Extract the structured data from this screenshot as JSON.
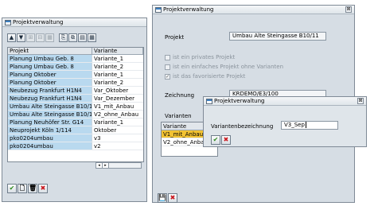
{
  "window1": {
    "title": "Projektverwaltung",
    "toolbar": [
      "▲",
      "▼",
      "⊞",
      "⊟",
      "▦",
      "⎘",
      "⧉",
      "▤",
      "▦"
    ],
    "table": {
      "headers": [
        "Projekt",
        "Variante"
      ],
      "rows": [
        [
          "Planung Umbau Geb. 8",
          "Variante_1"
        ],
        [
          "Planung Umbau Geb. 8",
          "Variante_2"
        ],
        [
          "Planung Oktober",
          "Variante_1"
        ],
        [
          "Planung Oktober",
          "Variante_2"
        ],
        [
          "Neubezug Frankfurt H1N4",
          "Var_Oktober"
        ],
        [
          "Neubezug Frankfurt H1N4",
          "Var_Dezember"
        ],
        [
          "Umbau Alte Steingasse B10/11",
          "V1_mit_Anbau"
        ],
        [
          "Umbau Alte Steingasse B10/11",
          "V2_ohne_Anbau"
        ],
        [
          "Planung Neuhöfer Str. G14",
          "Variante_1"
        ],
        [
          "Neuprojekt Köln 1/114",
          "Oktober"
        ],
        [
          "pko0204umbau",
          "v3"
        ],
        [
          "pko0204umbau",
          "v2"
        ]
      ]
    },
    "scroll": {
      "left": "◂",
      "right": "▸"
    },
    "bottom": {
      "check": "✔",
      "new": "🗋",
      "delete": "🗑",
      "cancel": "✖"
    }
  },
  "window2": {
    "title": "Projektverwaltung",
    "close": "⊠",
    "projekt_label": "Projekt",
    "projekt_value": "Umbau Alte Steingasse B10/11",
    "checkboxes": [
      {
        "label": "ist ein privates Projekt",
        "checked": false
      },
      {
        "label": "ist ein einfaches Projekt ohne Varianten",
        "checked": false
      },
      {
        "label": "ist das favorisierte Projekt",
        "checked": true
      }
    ],
    "checkmark": "✓",
    "zeichnung_label": "Zeichnung",
    "zeichnung_value": "KRDEMO/E3/100",
    "varianten_label": "Varianten",
    "varianten_tools": [
      "🗋",
      "✎",
      "🗑"
    ],
    "varianten_table": {
      "header": "Variante",
      "rows": [
        "V1_mit_Anbau",
        "V2_ohne_Anbau"
      ],
      "selected_index": 0
    },
    "bottom": {
      "save": "💾",
      "cancel": "✖"
    }
  },
  "dialog": {
    "title": "Projektverwaltung",
    "close": "⊠",
    "field_label": "Variantenbezeichnung",
    "field_value": "V3_Sep",
    "ok": "✔",
    "cancel": "✖"
  },
  "colors": {
    "window_bg": "#d6dde4",
    "project_cell_bg": "#b9d9ef",
    "selected_row": "#f1c232",
    "ok_green": "#2e8b1e",
    "cancel_red": "#c8161d"
  }
}
